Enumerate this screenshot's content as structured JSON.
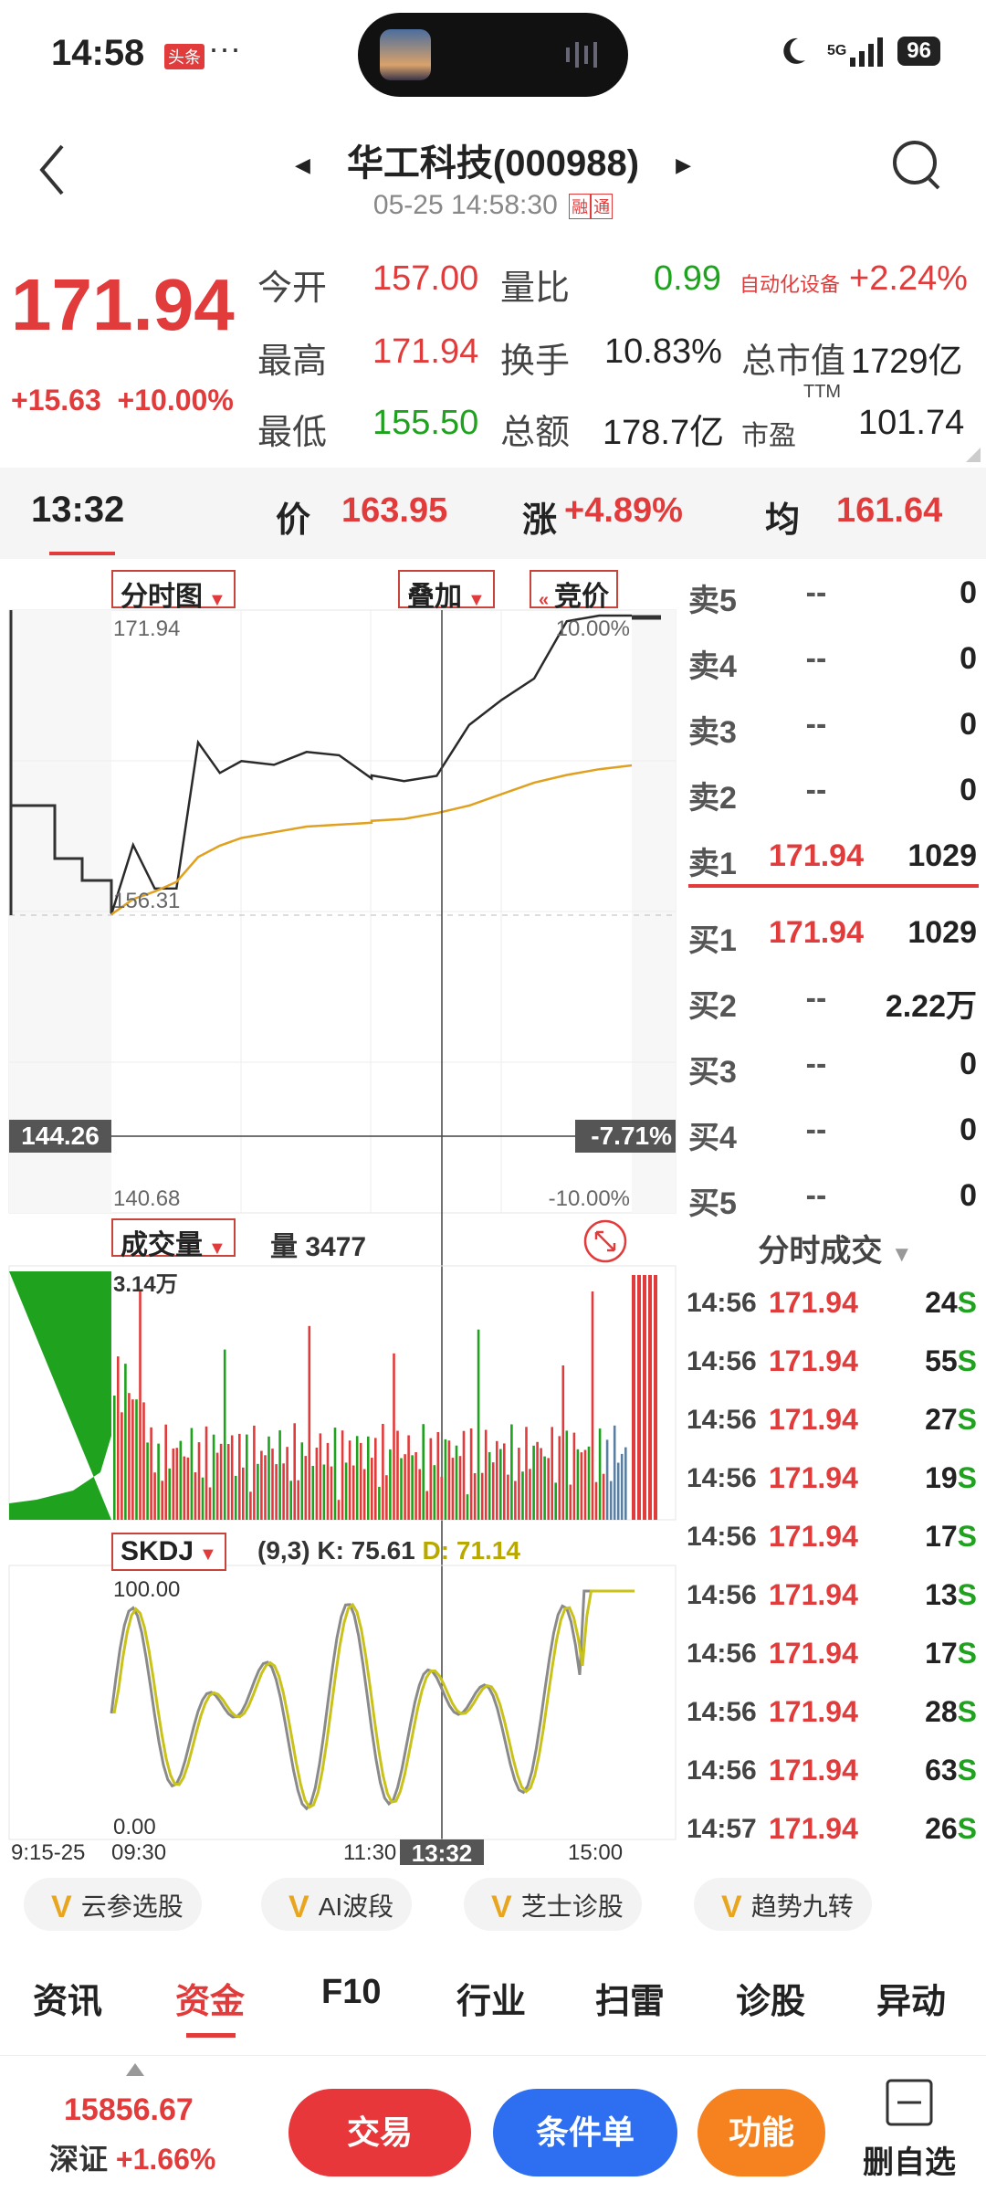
{
  "status_bar": {
    "time": "14:58",
    "badge": "头条",
    "dots": "···",
    "network": "5G",
    "battery": "96"
  },
  "header": {
    "stock_name": "华工科技(000988)",
    "datetime": "05-25 14:58:30",
    "tag_margin": "融",
    "tag_connect": "通"
  },
  "quote": {
    "price": "171.94",
    "change": "+15.63",
    "change_pct": "+10.00%",
    "open_label": "今开",
    "open": "157.00",
    "high_label": "最高",
    "high": "171.94",
    "low_label": "最低",
    "low": "155.50",
    "ratio_label": "量比",
    "ratio": "0.99",
    "turnover_label": "换手",
    "turnover": "10.83%",
    "amount_label": "总额",
    "amount": "178.7亿",
    "sector": "自动化设备",
    "sector_pct": "+2.24%",
    "mcap_label": "总市值",
    "mcap": "1729亿",
    "pe_label": "市盈",
    "pe_sup": "TTM",
    "pe": "101.74"
  },
  "crosshair": {
    "time": "13:32",
    "price_label": "价",
    "price": "163.95",
    "chg_label": "涨",
    "chg": "+4.89%",
    "avg_label": "均",
    "avg": "161.64"
  },
  "chart_controls": {
    "intraday": "分时图",
    "overlay": "叠加",
    "auction": "竞价",
    "volume": "成交量",
    "volume_label": "量",
    "volume_value": "3477",
    "indicator": "SKDJ",
    "indicator_params": "(9,3)",
    "k_label": "K: 75.61",
    "d_label": "D: 71.14"
  },
  "chart_labels": {
    "top": "171.94",
    "top_pct": "10.00%",
    "mid": "156.31",
    "cross_price": "144.26",
    "cross_pct": "-7.71%",
    "bottom": "140.68",
    "bottom_pct": "-10.00%",
    "vol_top": "3.14万",
    "kd_top": "100.00",
    "kd_bottom": "0.00",
    "x_labels": [
      "9:15-25",
      "09:30",
      "11:30",
      "15:00"
    ],
    "x_cursor": "13:32"
  },
  "chart_data": {
    "type": "line",
    "title": "",
    "ylim": [
      140.68,
      171.94
    ],
    "series": [
      {
        "name": "",
        "x": [
          "09:30",
          "09:40",
          "09:50",
          "10:00",
          "10:10",
          "10:20",
          "10:30",
          "10:45",
          "11:00",
          "11:15",
          "11:30",
          "13:00",
          "13:15",
          "13:30",
          "13:45",
          "14:00",
          "14:15",
          "14:30",
          "14:45",
          "15:00"
        ],
        "values": [
          156.3,
          159.6,
          158.1,
          157.4,
          165.2,
          164.1,
          163.9,
          164.3,
          165.0,
          164.2,
          163.8,
          163.5,
          163.0,
          164.0,
          165.9,
          167.5,
          169.0,
          171.2,
          171.94,
          171.94
        ]
      },
      {
        "name": "",
        "x": [
          "09:30",
          "09:40",
          "09:50",
          "10:00",
          "10:10",
          "10:20",
          "10:30",
          "10:45",
          "11:00",
          "11:15",
          "11:30",
          "13:00",
          "13:15",
          "13:30",
          "13:45",
          "14:00",
          "14:15",
          "14:30",
          "14:45",
          "15:00"
        ],
        "values": [
          156.3,
          157.1,
          157.5,
          158.0,
          159.3,
          159.9,
          160.3,
          160.6,
          160.9,
          161.0,
          161.1,
          161.2,
          161.3,
          161.6,
          162.0,
          162.6,
          163.2,
          163.6,
          163.9,
          164.1
        ]
      }
    ]
  },
  "order_book": [
    {
      "label": "卖5",
      "price": "--",
      "vol": "0"
    },
    {
      "label": "卖4",
      "price": "--",
      "vol": "0"
    },
    {
      "label": "卖3",
      "price": "--",
      "vol": "0"
    },
    {
      "label": "卖2",
      "price": "--",
      "vol": "0"
    },
    {
      "label": "卖1",
      "price": "171.94",
      "vol": "1029"
    },
    {
      "label": "买1",
      "price": "171.94",
      "vol": "1029"
    },
    {
      "label": "买2",
      "price": "--",
      "vol": "2.22万"
    },
    {
      "label": "买3",
      "price": "--",
      "vol": "0"
    },
    {
      "label": "买4",
      "price": "--",
      "vol": "0"
    },
    {
      "label": "买5",
      "price": "--",
      "vol": "0"
    }
  ],
  "ticks": {
    "title": "分时成交",
    "rows": [
      {
        "time": "14:56",
        "price": "171.94",
        "vol": "24",
        "side": "S"
      },
      {
        "time": "14:56",
        "price": "171.94",
        "vol": "55",
        "side": "S"
      },
      {
        "time": "14:56",
        "price": "171.94",
        "vol": "27",
        "side": "S"
      },
      {
        "time": "14:56",
        "price": "171.94",
        "vol": "19",
        "side": "S"
      },
      {
        "time": "14:56",
        "price": "171.94",
        "vol": "17",
        "side": "S"
      },
      {
        "time": "14:56",
        "price": "171.94",
        "vol": "13",
        "side": "S"
      },
      {
        "time": "14:56",
        "price": "171.94",
        "vol": "17",
        "side": "S"
      },
      {
        "time": "14:56",
        "price": "171.94",
        "vol": "28",
        "side": "S"
      },
      {
        "time": "14:56",
        "price": "171.94",
        "vol": "63",
        "side": "S"
      },
      {
        "time": "14:57",
        "price": "171.94",
        "vol": "26",
        "side": "S"
      }
    ]
  },
  "tools": [
    "云参选股",
    "AI波段",
    "芝士诊股",
    "趋势九转"
  ],
  "tools_v": "V",
  "tabs": [
    "资讯",
    "资金",
    "F10",
    "行业",
    "扫雷",
    "诊股",
    "异动"
  ],
  "bottom": {
    "index_value": "15856.67",
    "index_name": "深证",
    "index_pct": "+1.66%",
    "trade": "交易",
    "condition": "条件单",
    "function": "功能",
    "fav": "删自选"
  },
  "colors": {
    "up": "#e23b3b",
    "down": "#1fa31f",
    "avg_line": "#e0a020",
    "k_line": "#8a8a8a",
    "d_line": "#c9c21a",
    "trade_btn": "#e8373a",
    "cond_btn": "#2d6ff0",
    "func_btn": "#f5821f"
  }
}
